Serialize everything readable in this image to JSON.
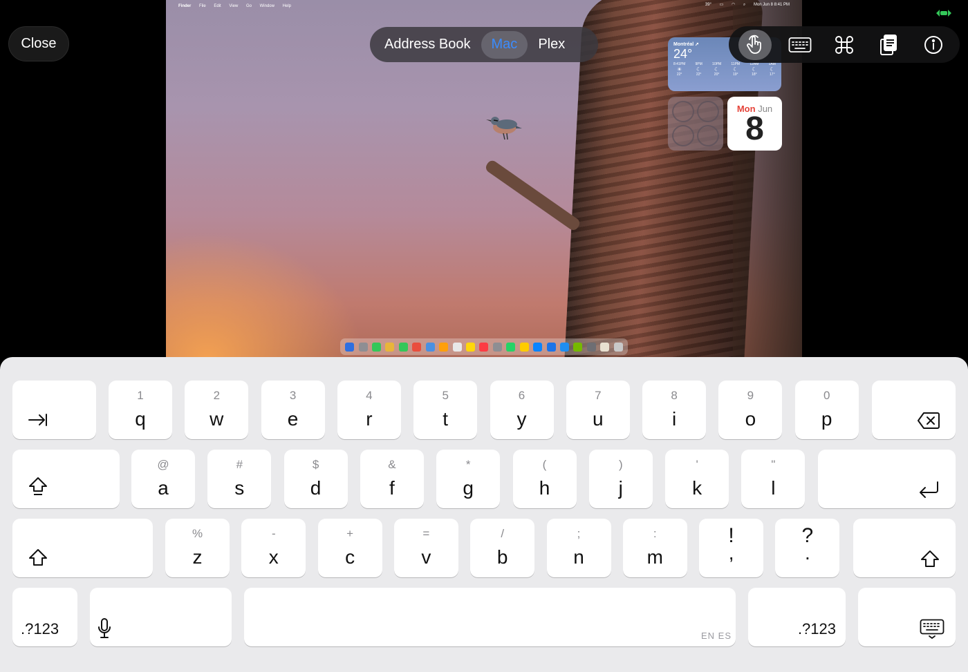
{
  "close_label": "Close",
  "segments": [
    {
      "label": "Address Book",
      "active": false
    },
    {
      "label": "Mac",
      "active": true
    },
    {
      "label": "Plex",
      "active": false
    }
  ],
  "toolbar": [
    "touch-pointer-icon",
    "keyboard-icon",
    "command-icon",
    "clipboard-icon",
    "info-icon"
  ],
  "remote": {
    "menubar": {
      "apple": "",
      "app": "Finder",
      "menus": [
        "File",
        "Edit",
        "View",
        "Go",
        "Window",
        "Help"
      ],
      "temp": "39°",
      "clock": "Mon Jun 8  8:41 PM"
    },
    "weather": {
      "city": "Montréal ➚",
      "temp": "24°",
      "hours": [
        {
          "time": "8:41PM",
          "temp": "22°"
        },
        {
          "time": "9PM",
          "temp": "22°"
        },
        {
          "time": "10PM",
          "temp": "20°"
        },
        {
          "time": "11PM",
          "temp": "19°"
        },
        {
          "time": "12AM",
          "temp": "18°"
        },
        {
          "time": "1AM",
          "temp": "17°"
        }
      ]
    },
    "calendar": {
      "weekday": "Mon",
      "month": "Jun",
      "day": "8"
    },
    "dock_colors": [
      "#2f6fe0",
      "#8e8e93",
      "#34c759",
      "#e8b53a",
      "#34c759",
      "#e94e3d",
      "#4a90e2",
      "#ff9f0a",
      "#e8e8e8",
      "#ffd60a",
      "#fc3c44",
      "#8e8e93",
      "#25d366",
      "#ffcc00",
      "#0a84ff",
      "#1c74e8",
      "#1f8ef1",
      "#76b900",
      "#6e6e73",
      "#e8e0d0",
      "#c8c8c8"
    ]
  },
  "keyboard": {
    "row1": [
      {
        "main": "q",
        "alt": "1"
      },
      {
        "main": "w",
        "alt": "2"
      },
      {
        "main": "e",
        "alt": "3"
      },
      {
        "main": "r",
        "alt": "4"
      },
      {
        "main": "t",
        "alt": "5"
      },
      {
        "main": "y",
        "alt": "6"
      },
      {
        "main": "u",
        "alt": "7"
      },
      {
        "main": "i",
        "alt": "8"
      },
      {
        "main": "o",
        "alt": "9"
      },
      {
        "main": "p",
        "alt": "0"
      }
    ],
    "row2": [
      {
        "main": "a",
        "alt": "@"
      },
      {
        "main": "s",
        "alt": "#"
      },
      {
        "main": "d",
        "alt": "$"
      },
      {
        "main": "f",
        "alt": "&"
      },
      {
        "main": "g",
        "alt": "*"
      },
      {
        "main": "h",
        "alt": "("
      },
      {
        "main": "j",
        "alt": ")"
      },
      {
        "main": "k",
        "alt": "'"
      },
      {
        "main": "l",
        "alt": "\""
      }
    ],
    "row3": [
      {
        "main": "z",
        "alt": "%"
      },
      {
        "main": "x",
        "alt": "-"
      },
      {
        "main": "c",
        "alt": "+"
      },
      {
        "main": "v",
        "alt": "="
      },
      {
        "main": "b",
        "alt": "/"
      },
      {
        "main": "n",
        "alt": ";"
      },
      {
        "main": "m",
        "alt": ":"
      },
      {
        "main": ",",
        "alt": "!"
      },
      {
        "main": ".",
        "alt": "?"
      }
    ],
    "numbers_label": ".?123",
    "numbers_label_right": ".?123",
    "space_lang": "EN ES",
    "icons": {
      "tab": "tab-icon",
      "delete": "delete-icon",
      "caps": "caps-lock-icon",
      "return": "return-icon",
      "shift": "shift-icon",
      "mic": "microphone-icon",
      "dismiss": "keyboard-dismiss-icon"
    }
  }
}
